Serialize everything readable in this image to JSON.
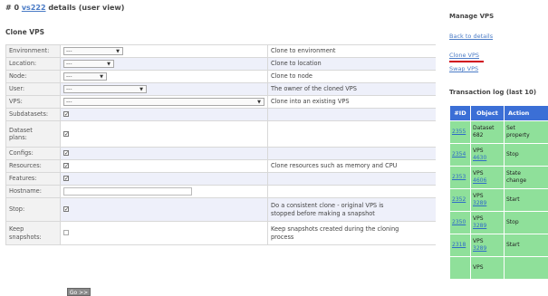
{
  "page": {
    "title_prefix": "# 0 ",
    "title_link": "vs222",
    "title_suffix": " details (user view)"
  },
  "clone_section": {
    "title": "Clone VPS"
  },
  "form": {
    "environment": {
      "label": "Environment:",
      "value": "---",
      "desc": "Clone to environment"
    },
    "location": {
      "label": "Location:",
      "value": "---",
      "desc": "Clone to location"
    },
    "node": {
      "label": "Node:",
      "value": "---",
      "desc": "Clone to node"
    },
    "user": {
      "label": "User:",
      "value": "---",
      "desc": "The owner of the cloned VPS"
    },
    "vps": {
      "label": "VPS:",
      "value": "---",
      "desc": "Clone into an existing VPS"
    },
    "subdatasets": {
      "label": "Subdatasets:",
      "checked": true
    },
    "dataset_plans": {
      "label_line1": "Dataset",
      "label_line2": "plans:",
      "checked": true
    },
    "configs": {
      "label": "Configs:",
      "checked": true
    },
    "resources": {
      "label": "Resources:",
      "checked": true,
      "desc": "Clone resources such as memory and CPU"
    },
    "features": {
      "label": "Features:",
      "checked": true
    },
    "hostname": {
      "label": "Hostname:",
      "value": ""
    },
    "stop": {
      "label": "Stop:",
      "checked": true,
      "desc_line1": "Do a consistent clone - original VPS is",
      "desc_line2": "stopped before making a snapshot"
    },
    "keep_snapshots": {
      "label_line1": "Keep",
      "label_line2": "snapshots:",
      "checked": false,
      "desc_line1": "Keep snapshots created during the cloning",
      "desc_line2": "process"
    },
    "submit_label": "Go >>"
  },
  "sidebar": {
    "manage_title": "Manage VPS",
    "links": {
      "back": "Back to details",
      "clone": "Clone VPS",
      "swap": "Swap VPS"
    },
    "log_title": "Transaction log (last 10)",
    "log_headers": [
      "#ID",
      "Object",
      "Action"
    ],
    "log_rows": [
      {
        "id": "2355",
        "obj1": "Dataset",
        "obj2": "682",
        "act1": "Set",
        "act2": "property"
      },
      {
        "id": "2354",
        "obj1": "VPS",
        "obj2": "4630",
        "act1": "Stop",
        "act2": ""
      },
      {
        "id": "2353",
        "obj1": "VPS",
        "obj2": "4606",
        "act1": "State",
        "act2": "change"
      },
      {
        "id": "2352",
        "obj1": "VPS",
        "obj2": "3289",
        "act1": "Start",
        "act2": ""
      },
      {
        "id": "2350",
        "obj1": "VPS",
        "obj2": "3289",
        "act1": "Stop",
        "act2": ""
      },
      {
        "id": "2318",
        "obj1": "VPS",
        "obj2": "3289",
        "act1": "Start",
        "act2": ""
      },
      {
        "id": "",
        "obj1": "VPS",
        "obj2": "",
        "act1": "",
        "act2": ""
      }
    ]
  },
  "colors": {
    "link": "#4a7bc6",
    "log_header_bg": "#3b6fd6",
    "log_row_bg": "#8fe09a",
    "active_marker": "#d0021b",
    "alt_row_bg": "#eef0fa"
  }
}
